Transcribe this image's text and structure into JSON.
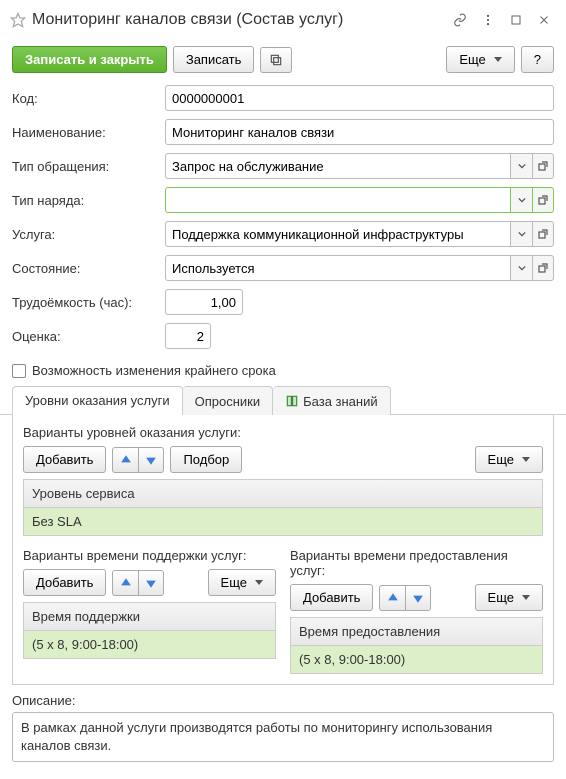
{
  "titlebar": {
    "title": "Мониторинг каналов связи (Состав услуг)"
  },
  "toolbar": {
    "save_close": "Записать и закрыть",
    "save": "Записать",
    "more": "Еще",
    "help": "?"
  },
  "form": {
    "code_label": "Код:",
    "code_value": "0000000001",
    "name_label": "Наименование:",
    "name_value": "Мониторинг каналов связи",
    "request_type_label": "Тип обращения:",
    "request_type_value": "Запрос на обслуживание",
    "order_type_label": "Тип наряда:",
    "order_type_value": "",
    "service_label": "Услуга:",
    "service_value": "Поддержка коммуникационной инфраструктуры",
    "state_label": "Состояние:",
    "state_value": "Используется",
    "effort_label": "Трудоёмкость (час):",
    "effort_value": "1,00",
    "rating_label": "Оценка:",
    "rating_value": "2",
    "deadline_change_label": "Возможность изменения крайнего срока"
  },
  "tabs": {
    "levels": "Уровни оказания услуги",
    "surveys": "Опросники",
    "kb": "База знаний"
  },
  "levels": {
    "variants_label": "Варианты уровней оказания услуги:",
    "add": "Добавить",
    "pick": "Подбор",
    "more": "Еще",
    "col_header": "Уровень сервиса",
    "row1": "Без SLA",
    "support_label": "Варианты времени поддержки услуг:",
    "support_header": "Время поддержки",
    "support_row": "(5 x 8, 9:00-18:00)",
    "provision_label": "Варианты времени предоставления услуг:",
    "provision_header": "Время предоставления",
    "provision_row": "(5 x 8, 9:00-18:00)"
  },
  "description": {
    "label": "Описание:",
    "text": "В рамках данной услуги производятся работы по мониторингу использования каналов связи."
  }
}
